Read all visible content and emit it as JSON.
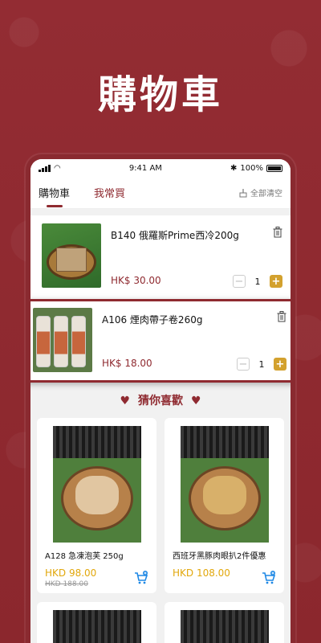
{
  "hero": {
    "title": "購物車"
  },
  "status_bar": {
    "time": "9:41 AM",
    "battery": "100%"
  },
  "tabs": [
    {
      "label": "購物車",
      "active": true
    },
    {
      "label": "我常買",
      "active": false
    }
  ],
  "clear_all": "全部清空",
  "cart_items": [
    {
      "name": "B140 俄羅斯Prime西冷200g",
      "price": "HK$ 30.00",
      "qty": "1"
    },
    {
      "name": "A106 煙肉帶子卷260g",
      "price": "HK$ 18.00",
      "qty": "1"
    }
  ],
  "recommend_title": "猜你喜歡",
  "recommend_items": [
    {
      "name": "A128 急凍泡芙 250g",
      "price": "HKD 98.00",
      "old_price": "HKD 188.00"
    },
    {
      "name": "西班牙黑豚肉眼扒2件優惠",
      "price": "HKD 108.00"
    }
  ],
  "colors": {
    "brand": "#8f2a30",
    "accent": "#d3a12e",
    "price_yellow": "#e2a80d"
  }
}
